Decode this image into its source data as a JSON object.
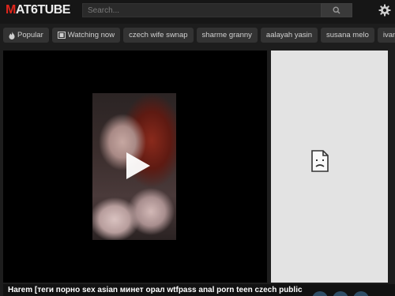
{
  "header": {
    "logo_first": "M",
    "logo_rest": "AT6TUBE",
    "search_placeholder": "Search..."
  },
  "tags": [
    {
      "label": "Popular",
      "icon": "fire-icon"
    },
    {
      "label": "Watching now",
      "icon": "film-icon"
    },
    {
      "label": "czech wife swnap"
    },
    {
      "label": "sharme granny"
    },
    {
      "label": "aalayah yasin"
    },
    {
      "label": "susana melo"
    },
    {
      "label": "ivana fukalot"
    }
  ],
  "video": {
    "title": "Harem [теги порно sex asian минет орал wtfpass anal porn teen czech public"
  },
  "colors": {
    "accent": "#e0261c",
    "background": "#1d1d1d",
    "ad_panel": "#e3e3e3"
  }
}
